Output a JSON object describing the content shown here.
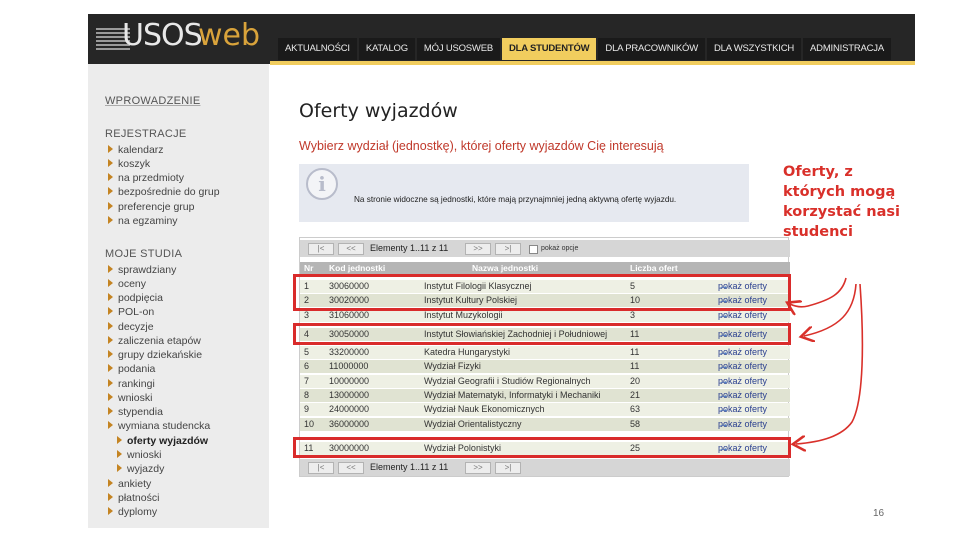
{
  "header": {
    "logo_usos": "USOS",
    "logo_web": "web",
    "tabs": [
      {
        "label": "AKTUALNOŚCI",
        "active": false
      },
      {
        "label": "KATALOG",
        "active": false
      },
      {
        "label": "MÓJ USOSWEB",
        "active": false
      },
      {
        "label": "DLA STUDENTÓW",
        "active": true
      },
      {
        "label": "DLA PRACOWNIKÓW",
        "active": false
      },
      {
        "label": "DLA WSZYSTKICH",
        "active": false
      },
      {
        "label": "ADMINISTRACJA",
        "active": false
      }
    ],
    "accent_color": "#f1cd5e"
  },
  "sidebar": {
    "intro": "WPROWADZENIE",
    "registration_title": "REJESTRACJE",
    "registration_items": [
      "kalendarz",
      "koszyk",
      "na przedmioty",
      "bezpośrednie do grup",
      "preferencje grup",
      "na egzaminy"
    ],
    "studies_title": "MOJE STUDIA",
    "studies_items": [
      "sprawdziany",
      "oceny",
      "podpięcia",
      "POL-on",
      "decyzje",
      "zaliczenia etapów",
      "grupy dziekańskie",
      "podania",
      "rankingi",
      "wnioski",
      "stypendia",
      "wymiana studencka"
    ],
    "exchange_sub": [
      "oferty wyjazdów",
      "wnioski",
      "wyjazdy"
    ],
    "bottom_items": [
      "ankiety",
      "płatności",
      "dyplomy"
    ]
  },
  "main": {
    "title": "Oferty wyjazdów",
    "subtitle": "Wybierz wydział (jednostkę), której oferty wyjazdów Cię interesują",
    "info_icon": "i",
    "info_text": "Na stronie widoczne są jednostki, które mają przynajmniej jedną aktywną ofertę wyjazdu."
  },
  "table": {
    "pager_first": "|<",
    "pager_prev": "<<",
    "pager_next": ">>",
    "pager_last": ">|",
    "pager_text": "Elementy 1..11 z 11",
    "checkbox_label": "pokaż opcje",
    "headers": {
      "nr": "Nr",
      "code": "Kod jednostki",
      "name": "Nazwa jednostki",
      "count": "Liczba ofert"
    },
    "rows": [
      {
        "nr": "1",
        "code": "30060000",
        "name": "Instytut Filologii Klasycznej",
        "count": "5",
        "link": "pokaż oferty"
      },
      {
        "nr": "2",
        "code": "30020000",
        "name": "Instytut Kultury Polskiej",
        "count": "10",
        "link": "pokaż oferty"
      },
      {
        "nr": "3",
        "code": "31060000",
        "name": "Instytut Muzykologii",
        "count": "3",
        "link": "pokaż oferty"
      },
      {
        "nr": "4",
        "code": "30050000",
        "name": "Instytut Słowiańskiej Zachodniej i Południowej",
        "count": "11",
        "link": "pokaż oferty"
      },
      {
        "nr": "5",
        "code": "33200000",
        "name": "Katedra Hungarystyki",
        "count": "11",
        "link": "pokaż oferty"
      },
      {
        "nr": "6",
        "code": "11000000",
        "name": "Wydział Fizyki",
        "count": "11",
        "link": "pokaż oferty"
      },
      {
        "nr": "7",
        "code": "10000000",
        "name": "Wydział Geografii i Studiów Regionalnych",
        "count": "20",
        "link": "pokaż oferty"
      },
      {
        "nr": "8",
        "code": "13000000",
        "name": "Wydział Matematyki, Informatyki i Mechaniki",
        "count": "21",
        "link": "pokaż oferty"
      },
      {
        "nr": "9",
        "code": "24000000",
        "name": "Wydział Nauk Ekonomicznych",
        "count": "63",
        "link": "pokaż oferty"
      },
      {
        "nr": "10",
        "code": "36000000",
        "name": "Wydział Orientalistyczny",
        "count": "58",
        "link": "pokaż oferty"
      },
      {
        "nr": "11",
        "code": "30000000",
        "name": "Wydział Polonistyki",
        "count": "25",
        "link": "pokaż oferty"
      }
    ]
  },
  "annotation": {
    "text": "Oferty, z których mogą korzystać nasi studenci",
    "color": "#d9302a"
  },
  "page_number": "16"
}
